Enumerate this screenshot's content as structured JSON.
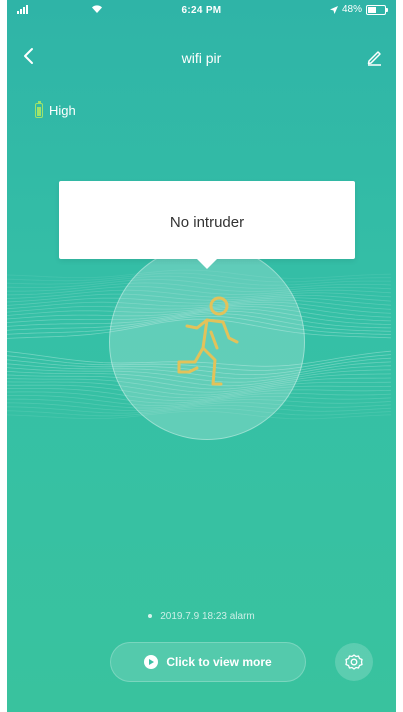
{
  "status_bar": {
    "time": "6:24 PM",
    "battery_text": "48%",
    "battery_level": 0.48
  },
  "nav": {
    "title": "wifi pir",
    "back_icon": "chevron-left-icon",
    "edit_icon": "pencil-icon"
  },
  "battery": {
    "label": "High",
    "color": "#9fe36a"
  },
  "sensor": {
    "status_text": "No intruder",
    "icon": "running-person-icon",
    "icon_color": "#e2c25a"
  },
  "alarm_log": {
    "text": "2019.7.9 18:23 alarm"
  },
  "actions": {
    "view_more_label": "Click to view more",
    "settings_icon": "gear-icon"
  },
  "colors": {
    "background_top": "#2fb4a7",
    "background_bottom": "#39c29e"
  }
}
